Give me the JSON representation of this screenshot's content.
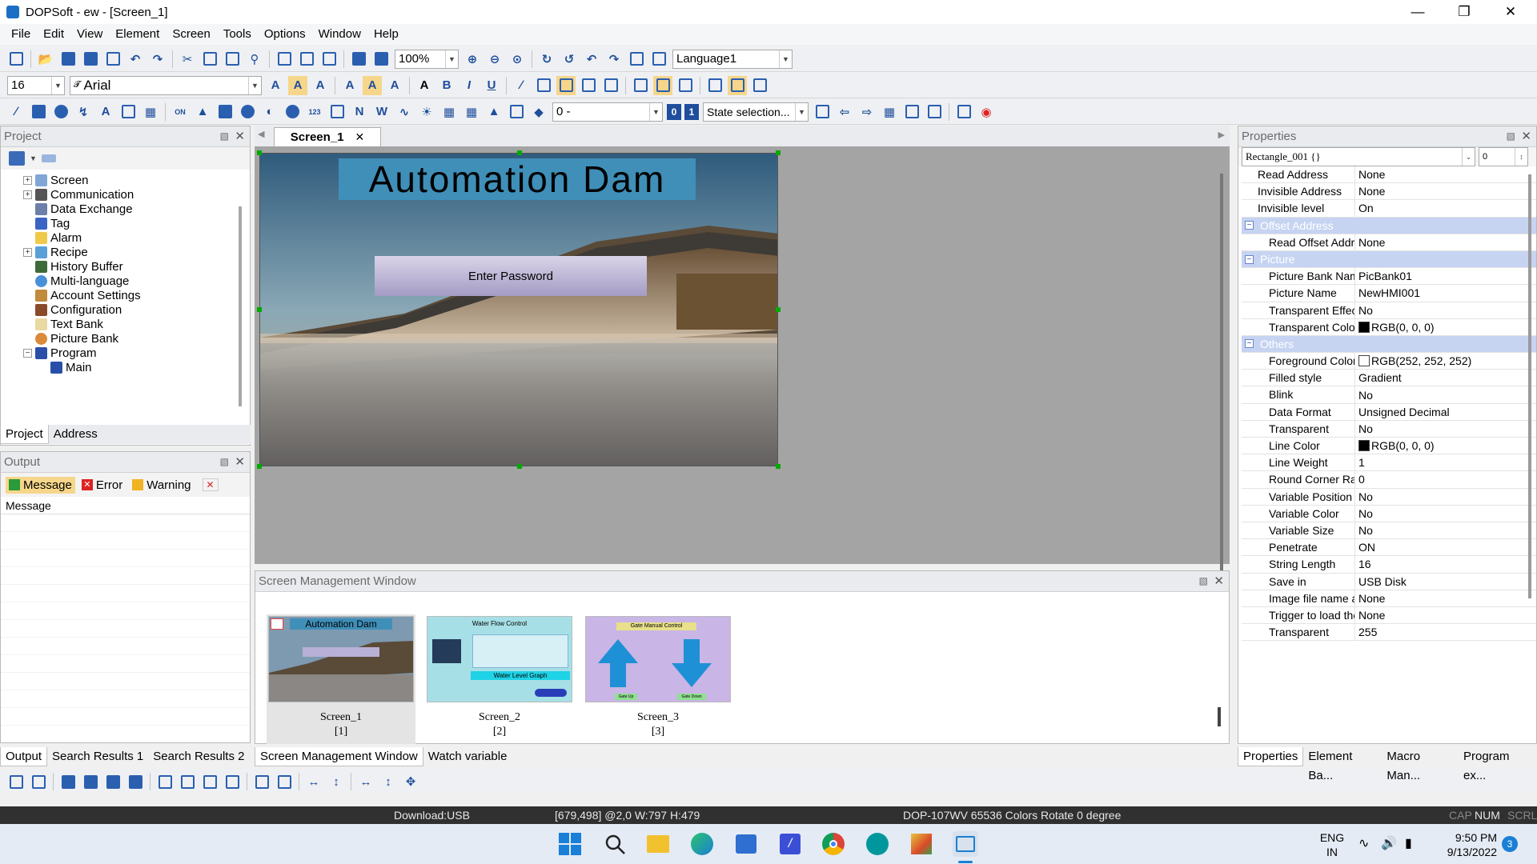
{
  "window": {
    "title": "DOPSoft - ew - [Screen_1]"
  },
  "menu": [
    "File",
    "Edit",
    "View",
    "Element",
    "Screen",
    "Tools",
    "Options",
    "Window",
    "Help"
  ],
  "toolbar": {
    "zoom": "100%",
    "language": "Language1",
    "font_size": "16",
    "font_name": "Arial",
    "state_value": "0 -",
    "state_selection": "State selection...",
    "state_btn_0": "0",
    "state_btn_1": "1"
  },
  "project": {
    "header": "Project",
    "items": [
      "Screen",
      "Communication",
      "Data Exchange",
      "Tag",
      "Alarm",
      "Recipe",
      "History Buffer",
      "Multi-language",
      "Account Settings",
      "Configuration",
      "Text Bank",
      "Picture Bank",
      "Program",
      "Main"
    ],
    "tabs": [
      "Project",
      "Address"
    ]
  },
  "output": {
    "header": "Output",
    "filters": [
      "Message",
      "Error",
      "Warning"
    ],
    "column": "Message"
  },
  "editor": {
    "tab": "Screen_1",
    "screen_title": "Automation Dam",
    "password_button": "Enter Password"
  },
  "screen_manager": {
    "header": "Screen Management Window",
    "screens": [
      {
        "name": "Screen_1",
        "index": "[1]",
        "caption": "Automation Dam"
      },
      {
        "name": "Screen_2",
        "index": "[2]",
        "caption": "Water Flow Control",
        "caption2": "Water Level Graph"
      },
      {
        "name": "Screen_3",
        "index": "[3]",
        "caption": "Gate Manual Control",
        "btn1": "Gate Up",
        "btn2": "Gate Down"
      }
    ]
  },
  "bottom_tabs_left": [
    "Output",
    "Search Results 1",
    "Search Results 2"
  ],
  "bottom_tabs_center": [
    "Screen Management Window",
    "Watch variable"
  ],
  "properties": {
    "header": "Properties",
    "selector": "Rectangle_001 {}",
    "selector_num": "0",
    "rows": [
      {
        "type": "row",
        "k": "Read Address",
        "v": "None",
        "indent": false
      },
      {
        "type": "row",
        "k": "Invisible Address",
        "v": "None",
        "indent": false
      },
      {
        "type": "row",
        "k": "Invisible level",
        "v": "On",
        "indent": false
      },
      {
        "type": "group",
        "k": "Offset Address"
      },
      {
        "type": "row",
        "k": "Read Offset Address",
        "v": "None",
        "indent": true
      },
      {
        "type": "group",
        "k": "Picture"
      },
      {
        "type": "row",
        "k": "Picture Bank Name",
        "v": "PicBank01",
        "indent": true
      },
      {
        "type": "row",
        "k": "Picture Name",
        "v": "NewHMI001",
        "indent": true
      },
      {
        "type": "row",
        "k": "Transparent Effect",
        "v": "No",
        "indent": true
      },
      {
        "type": "row",
        "k": "Transparent Color",
        "v": "RGB(0, 0, 0)",
        "swatch": "#000000",
        "indent": true
      },
      {
        "type": "group",
        "k": "Others"
      },
      {
        "type": "row",
        "k": "Foreground Color",
        "v": "RGB(252, 252, 252)",
        "swatch": "#fcfcfc",
        "indent": true
      },
      {
        "type": "row",
        "k": "Filled style",
        "v": "Gradient",
        "indent": true
      },
      {
        "type": "row",
        "k": "Blink",
        "v": "No",
        "indent": true
      },
      {
        "type": "row",
        "k": "Data Format",
        "v": "Unsigned Decimal",
        "indent": true
      },
      {
        "type": "row",
        "k": "Transparent",
        "v": "No",
        "indent": true
      },
      {
        "type": "row",
        "k": "Line Color",
        "v": "RGB(0, 0, 0)",
        "swatch": "#000000",
        "indent": true
      },
      {
        "type": "row",
        "k": "Line Weight",
        "v": "1",
        "indent": true
      },
      {
        "type": "row",
        "k": "Round Corner Radius",
        "v": "0",
        "indent": true
      },
      {
        "type": "row",
        "k": "Variable Position",
        "v": "No",
        "indent": true
      },
      {
        "type": "row",
        "k": "Variable Color",
        "v": "No",
        "indent": true
      },
      {
        "type": "row",
        "k": "Variable Size",
        "v": "No",
        "indent": true
      },
      {
        "type": "row",
        "k": "Penetrate",
        "v": "ON",
        "indent": true
      },
      {
        "type": "row",
        "k": "String Length",
        "v": "16",
        "indent": true
      },
      {
        "type": "row",
        "k": "Save in",
        "v": "USB Disk",
        "indent": true
      },
      {
        "type": "row",
        "k": "Image file name addr",
        "v": "None",
        "indent": true
      },
      {
        "type": "row",
        "k": "Trigger to load the im",
        "v": "None",
        "indent": true
      },
      {
        "type": "row",
        "k": "Transparent",
        "v": "255",
        "indent": true
      }
    ],
    "tabs": [
      "Properties",
      "Element Ba...",
      "Macro Man...",
      "Program ex..."
    ]
  },
  "status": {
    "download": "Download:USB",
    "position": "[679,498] @2,0 W:797 H:479",
    "device": "DOP-107WV 65536 Colors Rotate 0 degree",
    "cap": "CAP",
    "num": "NUM",
    "scrl": "SCRL"
  },
  "taskbar": {
    "lang1": "ENG",
    "lang2": "IN",
    "time": "9:50 PM",
    "date": "9/13/2022",
    "badge": "3"
  },
  "colors": {
    "accent": "#1a6fc4",
    "title_bg": "#3f8fb8",
    "status_bg": "#303030"
  }
}
